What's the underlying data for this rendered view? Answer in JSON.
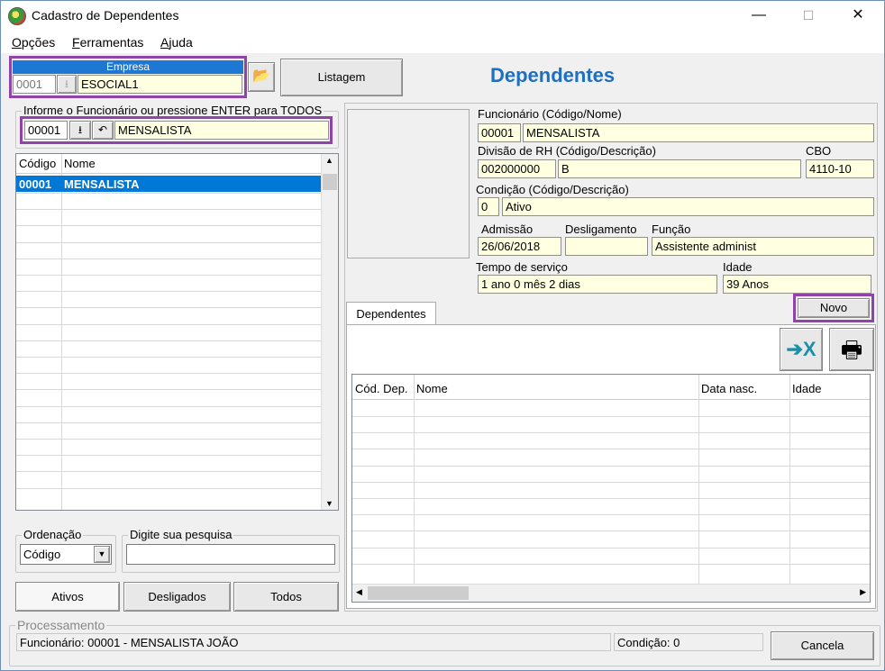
{
  "window": {
    "title": "Cadastro de Dependentes",
    "minimize": "—",
    "maximize": "☐",
    "close": "✕"
  },
  "menu": [
    {
      "label": "Opções",
      "accel": "O",
      "rest": "pções"
    },
    {
      "label": "Ferramentas",
      "accel": "F",
      "rest": "erramentas"
    },
    {
      "label": "Ajuda",
      "accel": "A",
      "rest": "juda"
    }
  ],
  "empresa": {
    "label": "Empresa",
    "code": "0001",
    "name": "ESOCIAL1"
  },
  "listagem_button": "Listagem",
  "page_heading": "Dependentes",
  "search_group": {
    "label": "Informe o Funcionário ou pressione ENTER para TODOS",
    "code": "00001",
    "name": "MENSALISTA"
  },
  "employee_grid": {
    "columns": [
      "Código",
      "Nome"
    ],
    "rows": [
      {
        "code": "00001",
        "name": "MENSALISTA",
        "selected": true
      }
    ]
  },
  "ordenacao": {
    "label": "Ordenação",
    "value": "Código"
  },
  "pesquisa": {
    "label": "Digite sua pesquisa",
    "value": ""
  },
  "filter_buttons": {
    "ativos": "Ativos",
    "desligados": "Desligados",
    "todos": "Todos"
  },
  "details": {
    "funcionario_label": "Funcionário (Código/Nome)",
    "funcionario_code": "00001",
    "funcionario_name": "MENSALISTA",
    "divisao_label": "Divisão de RH (Código/Descrição)",
    "divisao_code": "002000000",
    "divisao_desc": "B",
    "cbo_label": "CBO",
    "cbo_value": "4110-10",
    "condicao_label": "Condição (Código/Descrição)",
    "condicao_code": "0",
    "condicao_desc": "Ativo",
    "admissao_label": "Admissão",
    "admissao_value": "26/06/2018",
    "desligamento_label": "Desligamento",
    "desligamento_value": "",
    "funcao_label": "Função",
    "funcao_value": "Assistente administ",
    "tempo_label": "Tempo de serviço",
    "tempo_value": "1 ano 0 mês 2 dias",
    "idade_label": "Idade",
    "idade_value": "39 Anos"
  },
  "novo_button": "Novo",
  "tab_dependentes": "Dependentes",
  "dependents_grid": {
    "columns": [
      "Cód. Dep.",
      "Nome",
      "Data nasc.",
      "Idade"
    ],
    "rows": []
  },
  "processamento": {
    "label": "Processamento",
    "status": "Funcionário: 00001 - MENSALISTA JOÃO",
    "condicao": "Condição: 0"
  },
  "cancela_button": "Cancela"
}
